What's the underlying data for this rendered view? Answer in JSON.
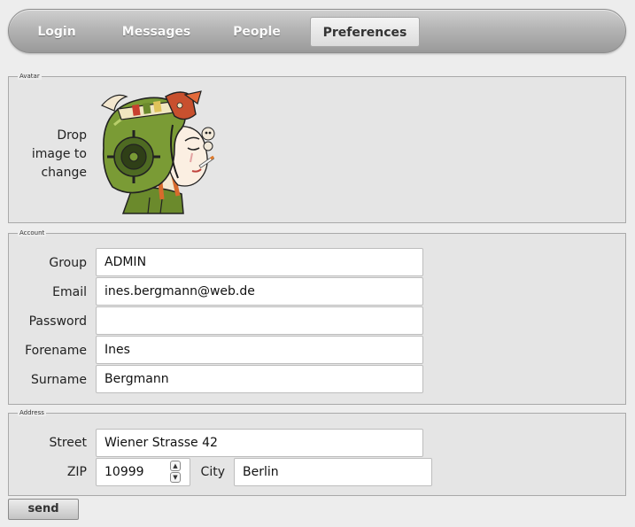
{
  "nav": {
    "items": [
      {
        "label": "Login"
      },
      {
        "label": "Messages"
      },
      {
        "label": "People"
      },
      {
        "label": "Preferences",
        "active": true
      }
    ]
  },
  "avatar": {
    "legend": "Avatar",
    "drop_text": [
      "Drop",
      "image to",
      "change"
    ],
    "image_icon": "punk-girl-helmet-illustration"
  },
  "account": {
    "legend": "Account",
    "fields": [
      {
        "label": "Group",
        "value": "ADMIN"
      },
      {
        "label": "Email",
        "value": "ines.bergmann@web.de"
      },
      {
        "label": "Password",
        "value": ""
      },
      {
        "label": "Forename",
        "value": "Ines"
      },
      {
        "label": "Surname",
        "value": "Bergmann"
      }
    ]
  },
  "address": {
    "legend": "Address",
    "street_label": "Street",
    "street_value": "Wiener Strasse 42",
    "zip_label": "ZIP",
    "zip_value": "10999",
    "city_label": "City",
    "city_value": "Berlin"
  },
  "send_label": "send",
  "colors": {
    "nav_gradient_top": "#cfcfcf",
    "nav_gradient_bottom": "#9a9a9a",
    "panel_bg": "#e5e5e5"
  }
}
